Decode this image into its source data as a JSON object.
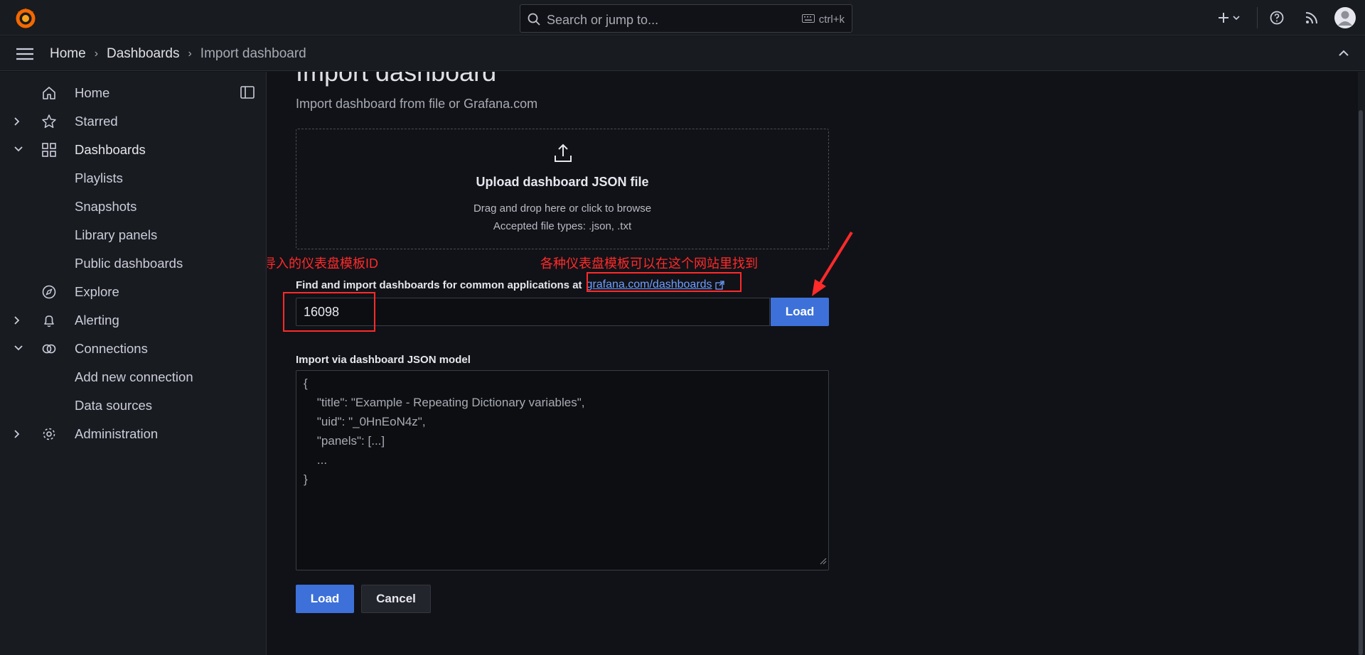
{
  "topbar": {
    "search_placeholder": "Search or jump to...",
    "search_shortcut": "ctrl+k"
  },
  "breadcrumb": [
    "Home",
    "Dashboards",
    "Import dashboard"
  ],
  "sidebar": {
    "items": [
      {
        "label": "Home",
        "icon": "home-icon"
      },
      {
        "label": "Starred",
        "icon": "star-icon"
      },
      {
        "label": "Dashboards",
        "icon": "apps-icon"
      },
      {
        "label": "Playlists"
      },
      {
        "label": "Snapshots"
      },
      {
        "label": "Library panels"
      },
      {
        "label": "Public dashboards"
      },
      {
        "label": "Explore",
        "icon": "compass-icon"
      },
      {
        "label": "Alerting",
        "icon": "bell-icon"
      },
      {
        "label": "Connections",
        "icon": "link-icon"
      },
      {
        "label": "Add new connection"
      },
      {
        "label": "Data sources"
      },
      {
        "label": "Administration",
        "icon": "cog-icon"
      }
    ]
  },
  "main": {
    "title": "Import dashboard",
    "subtitle": "Import dashboard from file or Grafana.com",
    "upload": {
      "title": "Upload dashboard JSON file",
      "line1": "Drag and drop here or click to browse",
      "line2": "Accepted file types: .json, .txt"
    },
    "annotation_left": "输入要导入的仪表盘模板ID",
    "annotation_right": "各种仪表盘模板可以在这个网站里找到",
    "find_label": "Find and import dashboards for common applications at",
    "find_link": "grafana.com/dashboards",
    "id_value": "16098",
    "load_label": "Load",
    "json_label": "Import via dashboard JSON model",
    "json_lines": [
      "{",
      "    \"title\": \"Example - Repeating Dictionary variables\",",
      "    \"uid\": \"_0HnEoN4z\",",
      "    \"panels\": [...]",
      "    ...",
      "}"
    ],
    "load_button": "Load",
    "cancel_button": "Cancel"
  },
  "colors": {
    "accent": "#3d71d9",
    "annotation": "#ff2a2a",
    "link": "#6e9fff"
  }
}
